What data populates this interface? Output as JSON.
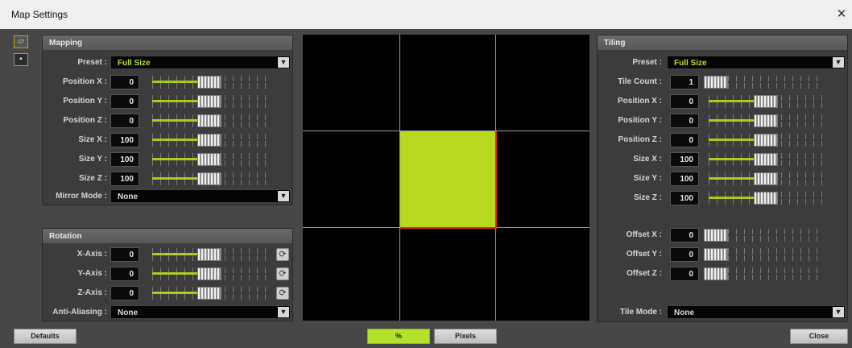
{
  "window": {
    "title": "Map Settings"
  },
  "side_icons": [
    {
      "name": "open-folder-icon",
      "glyph": "▭"
    },
    {
      "name": "save-disk-icon",
      "glyph": "▣"
    }
  ],
  "mapping": {
    "title": "Mapping",
    "preset_label": "Preset :",
    "preset_value": "Full Size",
    "fields": [
      {
        "label": "Position X :",
        "value": "0",
        "fill_fraction": 0.5
      },
      {
        "label": "Position Y :",
        "value": "0",
        "fill_fraction": 0.5
      },
      {
        "label": "Position Z :",
        "value": "0",
        "fill_fraction": 0.5
      },
      {
        "label": "Size X :",
        "value": "100",
        "fill_fraction": 0.5
      },
      {
        "label": "Size Y :",
        "value": "100",
        "fill_fraction": 0.5
      },
      {
        "label": "Size Z :",
        "value": "100",
        "fill_fraction": 0.5
      }
    ],
    "mirror_label": "Mirror Mode :",
    "mirror_value": "None"
  },
  "rotation": {
    "title": "Rotation",
    "fields": [
      {
        "label": "X-Axis :",
        "value": "0",
        "fill_fraction": 0.5
      },
      {
        "label": "Y-Axis :",
        "value": "0",
        "fill_fraction": 0.5
      },
      {
        "label": "Z-Axis :",
        "value": "0",
        "fill_fraction": 0.5
      }
    ],
    "reset_glyph": "⟳",
    "antialias_label": "Anti-Aliasing :",
    "antialias_value": "None"
  },
  "tiling": {
    "title": "Tiling",
    "preset_label": "Preset :",
    "preset_value": "Full Size",
    "tile_count_label": "Tile Count :",
    "tile_count_value": "1",
    "fields": [
      {
        "label": "Position X :",
        "value": "0",
        "fill_fraction": 0.5
      },
      {
        "label": "Position Y :",
        "value": "0",
        "fill_fraction": 0.5
      },
      {
        "label": "Position Z :",
        "value": "0",
        "fill_fraction": 0.5
      },
      {
        "label": "Size X :",
        "value": "100",
        "fill_fraction": 0.5
      },
      {
        "label": "Size Y :",
        "value": "100",
        "fill_fraction": 0.5
      },
      {
        "label": "Size Z :",
        "value": "100",
        "fill_fraction": 0.5
      }
    ],
    "offsets": [
      {
        "label": "Offset X :",
        "value": "0"
      },
      {
        "label": "Offset Y :",
        "value": "0"
      },
      {
        "label": "Offset Z :",
        "value": "0"
      }
    ],
    "tile_mode_label": "Tile Mode :",
    "tile_mode_value": "None"
  },
  "bottom": {
    "defaults": "Defaults",
    "percent": "%",
    "pixels": "Pixels",
    "close": "Close"
  },
  "colors": {
    "accent": "#b4e22b",
    "preview_tile": "#b5d91f",
    "tile_border": "#e0241e"
  }
}
